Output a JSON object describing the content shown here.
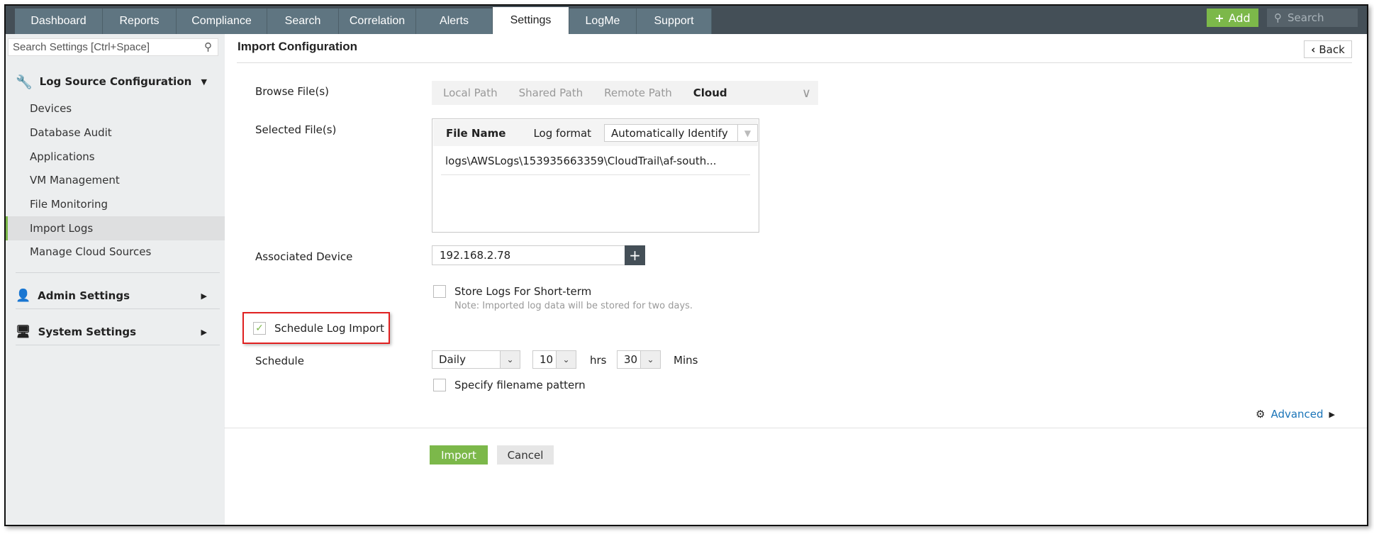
{
  "nav": {
    "tabs": [
      "Dashboard",
      "Reports",
      "Compliance",
      "Search",
      "Correlation",
      "Alerts",
      "Settings",
      "LogMe",
      "Support"
    ],
    "active": "Settings",
    "add_label": "Add",
    "search_placeholder": "Search"
  },
  "sidebar": {
    "search_placeholder": "Search Settings [Ctrl+Space]",
    "sections": [
      {
        "label": "Log Source Configuration"
      },
      {
        "label": "Admin Settings"
      },
      {
        "label": "System Settings"
      }
    ],
    "items": [
      "Devices",
      "Database Audit",
      "Applications",
      "VM Management",
      "File Monitoring",
      "Import Logs",
      "Manage Cloud Sources"
    ],
    "active_item": "Import Logs"
  },
  "main": {
    "title": "Import Configuration",
    "back_label": "Back",
    "browse": {
      "label": "Browse File(s)",
      "options": [
        "Local Path",
        "Shared Path",
        "Remote Path",
        "Cloud"
      ],
      "selected": "Cloud"
    },
    "selected_files": {
      "label": "Selected File(s)",
      "col_file": "File Name",
      "col_format": "Log format",
      "format_value": "Automatically Identify",
      "files": [
        "logs\\AWSLogs\\153935663359\\CloudTrail\\af-south..."
      ]
    },
    "device": {
      "label": "Associated Device",
      "value": "192.168.2.78"
    },
    "store_short": {
      "label": "Store Logs For Short-term",
      "note": "Note: Imported log data will be stored for two days.",
      "checked": false
    },
    "schedule_import": {
      "label": "Schedule Log Import",
      "checked": true
    },
    "schedule": {
      "label": "Schedule",
      "frequency": "Daily",
      "hours": "10",
      "hrs_label": "hrs",
      "minutes": "30",
      "mins_label": "Mins"
    },
    "filename_pattern": {
      "label": "Specify filename pattern",
      "checked": false
    },
    "advanced_label": "Advanced",
    "import_label": "Import",
    "cancel_label": "Cancel"
  },
  "colors": {
    "accent": "#7cb84a",
    "nav": "#5f7581",
    "highlight": "#e02020"
  }
}
